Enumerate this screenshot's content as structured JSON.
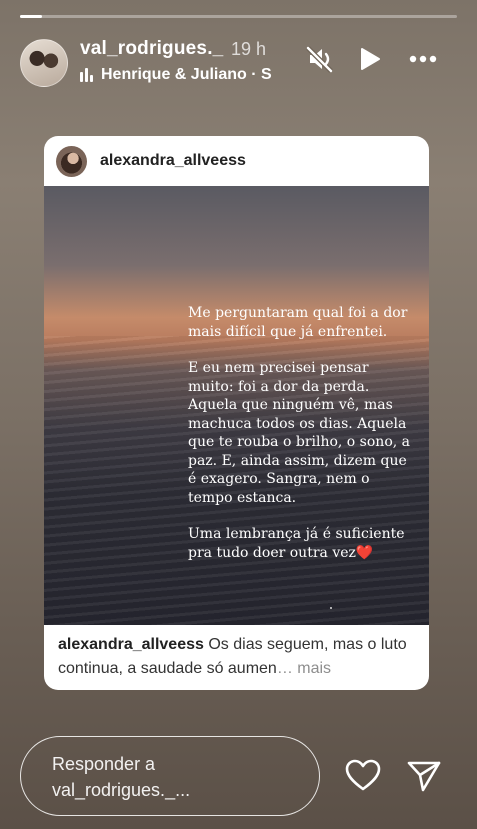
{
  "progress": {
    "fraction": 0.05
  },
  "header": {
    "username": "val_rodrigues._",
    "time": "19 h",
    "music": "Henrique & Juliano · S"
  },
  "icons": {
    "mute": "speaker-mute-icon",
    "play": "play-icon",
    "more": "more-options-icon",
    "music": "audio-bars-icon",
    "like": "heart-icon",
    "share": "send-icon"
  },
  "card": {
    "username": "alexandra_allveess",
    "quote": [
      "Me perguntaram qual foi a dor mais difícil que já enfrentei.",
      "E eu nem precisei pensar muito: foi a dor da perda. Aquela que ninguém vê, mas machuca todos os dias. Aquela que te rouba o brilho, o sono, a paz. E, ainda assim, dizem que é exagero. Sangra, nem o tempo estanca.",
      "Uma lembrança já é suficiente pra tudo doer outra vez"
    ],
    "heart": "❤️",
    "caption_user": "alexandra_allveess",
    "caption_text": "Os dias seguem, mas o luto continua, a saudade só aumen",
    "caption_more": "… mais"
  },
  "footer": {
    "reply_placeholder_line1": "Responder a",
    "reply_placeholder_line2": "val_rodrigues._..."
  }
}
